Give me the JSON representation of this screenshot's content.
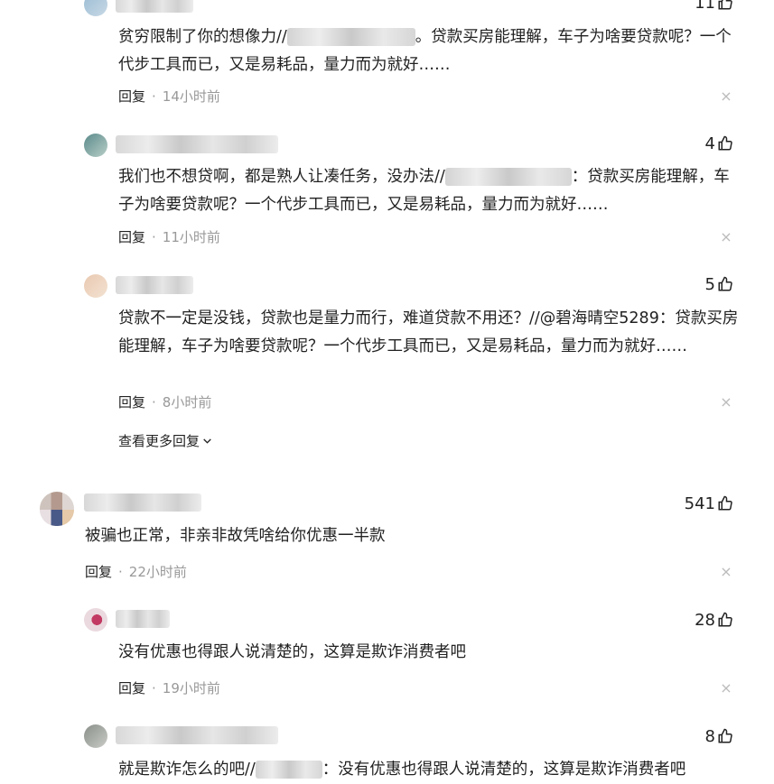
{
  "comments": [
    {
      "likes": "11",
      "text_before": "贫穷限制了你的想像力//",
      "text_after": "。贷款买房能理解，车子为啥要贷款呢？一个代步工具而已，又是易耗品，量力而为就好……",
      "reply": "回复",
      "time": "14小时前"
    },
    {
      "likes": "4",
      "text_before": "我们也不想贷啊，都是熟人让凑任务，没办法//",
      "text_after": "：贷款买房能理解，车子为啥要贷款呢？一个代步工具而已，又是易耗品，量力而为就好……",
      "reply": "回复",
      "time": "11小时前"
    },
    {
      "likes": "5",
      "text": "贷款不一定是没钱，贷款也是量力而行，难道贷款不用还？//@碧海晴空5289：贷款买房能理解，车子为啥要贷款呢？一个代步工具而已，又是易耗品，量力而为就好……",
      "reply": "回复",
      "time": "8小时前"
    },
    {
      "likes": "541",
      "text": "被骗也正常，非亲非故凭啥给你优惠一半款",
      "reply": "回复",
      "time": "22小时前"
    },
    {
      "likes": "28",
      "text": "没有优惠也得跟人说清楚的，这算是欺诈消费者吧",
      "reply": "回复",
      "time": "19小时前"
    },
    {
      "likes": "8",
      "text_before": "就是欺诈怎么的吧//",
      "text_after": "：没有优惠也得跟人说清楚的，这算是欺诈消费者吧"
    }
  ],
  "view_more": "查看更多回复",
  "close_glyph": "×",
  "dot": "·",
  "icons": {
    "like": "thumbs-up-icon",
    "close": "close-icon",
    "chevron": "chevron-down-icon"
  }
}
